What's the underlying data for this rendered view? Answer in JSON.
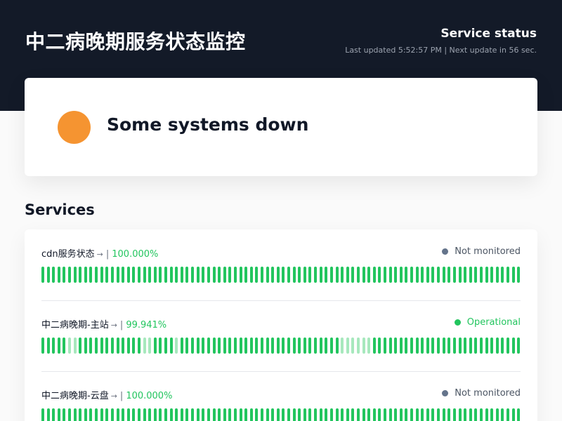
{
  "header": {
    "site_title": "中二病晚期服务状态监控",
    "service_status_title": "Service status",
    "last_updated": "Last updated 5:52:57 PM | Next update in 56 sec."
  },
  "summary": {
    "text": "Some systems down",
    "color": "#f59431"
  },
  "services_heading": "Services",
  "colors": {
    "up": "#22c55e",
    "partial": "#a7e8bd",
    "operational": "#22c55e",
    "not_monitored": "#64748b",
    "header_bg": "#131a28"
  },
  "services": [
    {
      "name": "cdn服务状态",
      "arrow_icon": "arrow-right-icon",
      "separator": "|",
      "uptime": "100.000%",
      "status": "Not monitored",
      "status_color": "#64748b",
      "status_text_color": "#4b5563",
      "bars": [
        1,
        1,
        1,
        1,
        1,
        1,
        1,
        1,
        1,
        1,
        1,
        1,
        1,
        1,
        1,
        1,
        1,
        1,
        1,
        1,
        1,
        1,
        1,
        1,
        1,
        1,
        1,
        1,
        1,
        1,
        1,
        1,
        1,
        1,
        1,
        1,
        1,
        1,
        1,
        1,
        1,
        1,
        1,
        1,
        1,
        1,
        1,
        1,
        1,
        1,
        1,
        1,
        1,
        1,
        1,
        1,
        1,
        1,
        1,
        1,
        1,
        1,
        1,
        1,
        1,
        1,
        1,
        1,
        1,
        1,
        1,
        1,
        1,
        1,
        1,
        1,
        1,
        1,
        1,
        1,
        1,
        1,
        1,
        1,
        1,
        1,
        1,
        1,
        1,
        1
      ]
    },
    {
      "name": "中二病晚期-主站",
      "arrow_icon": "arrow-right-icon",
      "separator": "|",
      "uptime": "99.941%",
      "status": "Operational",
      "status_color": "#22c55e",
      "status_text_color": "#22c55e",
      "bars": [
        1,
        1,
        1,
        1,
        1,
        0,
        0,
        1,
        1,
        1,
        1,
        1,
        1,
        1,
        1,
        1,
        1,
        1,
        1,
        0,
        0,
        1,
        1,
        1,
        1,
        0,
        1,
        1,
        1,
        1,
        1,
        1,
        1,
        1,
        1,
        1,
        1,
        1,
        1,
        1,
        1,
        1,
        1,
        1,
        1,
        1,
        1,
        1,
        1,
        1,
        1,
        1,
        1,
        1,
        1,
        1,
        0,
        0,
        0,
        0,
        0,
        0,
        1,
        1,
        1,
        1,
        1,
        1,
        1,
        1,
        1,
        1,
        1,
        1,
        1,
        1,
        1,
        1,
        1,
        1,
        1,
        1,
        1,
        1,
        1,
        1,
        1,
        1,
        1,
        1
      ]
    },
    {
      "name": "中二病晚期-云盘",
      "arrow_icon": "arrow-right-icon",
      "separator": "|",
      "uptime": "100.000%",
      "status": "Not monitored",
      "status_color": "#64748b",
      "status_text_color": "#4b5563",
      "bars": [
        1,
        1,
        1,
        1,
        1,
        1,
        1,
        1,
        1,
        1,
        1,
        1,
        1,
        1,
        1,
        1,
        1,
        1,
        1,
        1,
        1,
        1,
        1,
        1,
        1,
        1,
        1,
        1,
        1,
        1,
        1,
        1,
        1,
        1,
        1,
        1,
        1,
        1,
        1,
        1,
        1,
        1,
        1,
        1,
        1,
        1,
        1,
        1,
        1,
        1,
        1,
        1,
        1,
        1,
        1,
        1,
        1,
        1,
        1,
        1,
        1,
        1,
        1,
        1,
        1,
        1,
        1,
        1,
        1,
        1,
        1,
        1,
        1,
        1,
        1,
        1,
        1,
        1,
        1,
        1,
        1,
        1,
        1,
        1,
        1,
        1,
        1,
        1,
        1,
        1
      ]
    }
  ]
}
